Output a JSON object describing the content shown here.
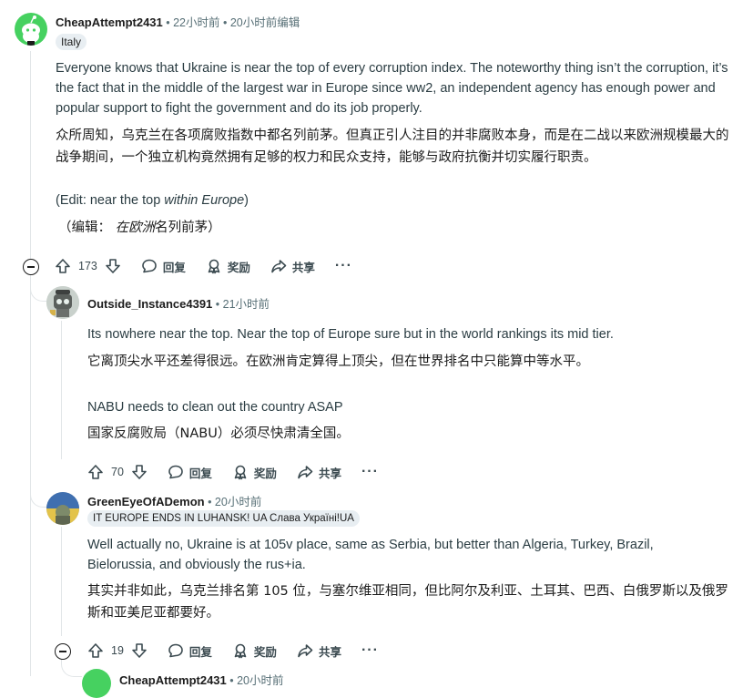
{
  "comments": [
    {
      "author": "CheapAttempt2431",
      "meta": " • 22小时前 • 20小时前编辑",
      "flair": "Italy",
      "paragraphs": [
        "Everyone knows that Ukraine is near the top of every corruption index. The noteworthy thing isn’t the corruption, it’s the fact that in the middle of the largest war in Europe since ww2, an independent agency has enough power and popular support to fight the government and do its job properly.",
        "众所周知，乌克兰在各项腐败指数中都名列前茅。但真正引人注目的并非腐败本身，而是在二战以来欧洲规模最大的战争期间，一个独立机构竟然拥有足够的权力和民众支持，能够与政府抗衡并切实履行职责。"
      ],
      "edit_en_prefix": "(Edit: near the top ",
      "edit_en_italic": "within Europe",
      "edit_en_suffix": ")",
      "edit_zh_prefix": "（编辑：",
      "edit_zh_italic": "在欧洲",
      "edit_zh_suffix": "名列前茅）",
      "votes": "173"
    },
    {
      "author": "Outside_Instance4391",
      "meta": " • 21小时前",
      "paragraphs": [
        "Its nowhere near the top. Near the top of Europe sure but in the world rankings its mid tier.",
        "它离顶尖水平还差得很远。在欧洲肯定算得上顶尖，但在世界排名中只能算中等水平。",
        "NABU needs to clean out the country ASAP",
        "国家反腐败局（NABU）必须尽快肃清全国。"
      ],
      "votes": "70"
    },
    {
      "author": "GreenEyeOfADemon",
      "meta": " • 20小时前",
      "flair": "IT EUROPE ENDS IN LUHANSK! UA Слава Україні!UA",
      "paragraphs": [
        "Well actually no, Ukraine is at 105v place, same as Serbia, but better than Algeria, Turkey, Brazil, Bielorussia, and obviously the rus+ia.",
        "其实并非如此，乌克兰排名第 105 位，与塞尔维亚相同，但比阿尔及利亚、土耳其、巴西、白俄罗斯以及俄罗斯和亚美尼亚都要好。"
      ],
      "votes": "19"
    },
    {
      "author": "CheapAttempt2431",
      "meta": " • 20小时前"
    }
  ],
  "labels": {
    "reply": "回复",
    "award": "奖励",
    "share": "共享",
    "more": "···"
  },
  "colors": {
    "accent_green": "#46d160",
    "text_meta": "#576f76",
    "rail": "#e2e6e8"
  },
  "icons": [
    "upvote-icon",
    "downvote-icon",
    "comment-icon",
    "award-icon",
    "share-icon",
    "collapse-icon",
    "more-icon"
  ]
}
